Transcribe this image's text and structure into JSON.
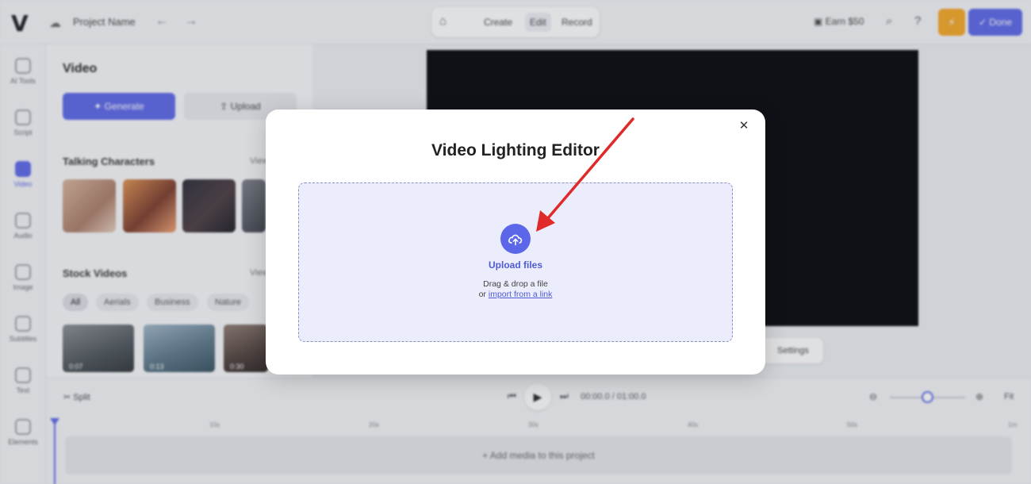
{
  "header": {
    "project_name": "Project Name",
    "modes": [
      "Create",
      "Edit",
      "Record"
    ],
    "earn": "Earn $50",
    "done": "Done"
  },
  "rail": [
    {
      "label": "AI Tools",
      "icon": "ai-tools-icon"
    },
    {
      "label": "Script",
      "icon": "script-icon"
    },
    {
      "label": "Video",
      "icon": "video-icon",
      "active": true
    },
    {
      "label": "Audio",
      "icon": "audio-icon"
    },
    {
      "label": "Image",
      "icon": "image-icon"
    },
    {
      "label": "Subtitles",
      "icon": "subtitles-icon"
    },
    {
      "label": "Text",
      "icon": "text-icon"
    },
    {
      "label": "Elements",
      "icon": "elements-icon"
    }
  ],
  "panel": {
    "title": "Video",
    "generate": "Generate",
    "upload": "Upload",
    "talking_title": "Talking Characters",
    "stock_title": "Stock Videos",
    "view_all": "View",
    "chips": [
      "All",
      "Aerials",
      "Business",
      "Nature"
    ],
    "durations": [
      "0:07",
      "0:13",
      "0:30"
    ]
  },
  "stage": {
    "settings": "Settings"
  },
  "timeline": {
    "split": "Split",
    "time": "00:00.0  /  01:00.0",
    "fit": "Fit",
    "ruler": [
      "10s",
      "20s",
      "30s",
      "40s",
      "50s",
      "1m"
    ],
    "add_media": "+  Add media to this project"
  },
  "modal": {
    "title": "Video Lighting Editor",
    "upload_label": "Upload files",
    "drag_text": "Drag & drop a file",
    "or_text": "or",
    "import_link": "import from a link"
  },
  "colors": {
    "accent": "#5b66e8",
    "annotation_arrow": "#e02a2a",
    "dropzone_bg": "#ecedfc"
  }
}
